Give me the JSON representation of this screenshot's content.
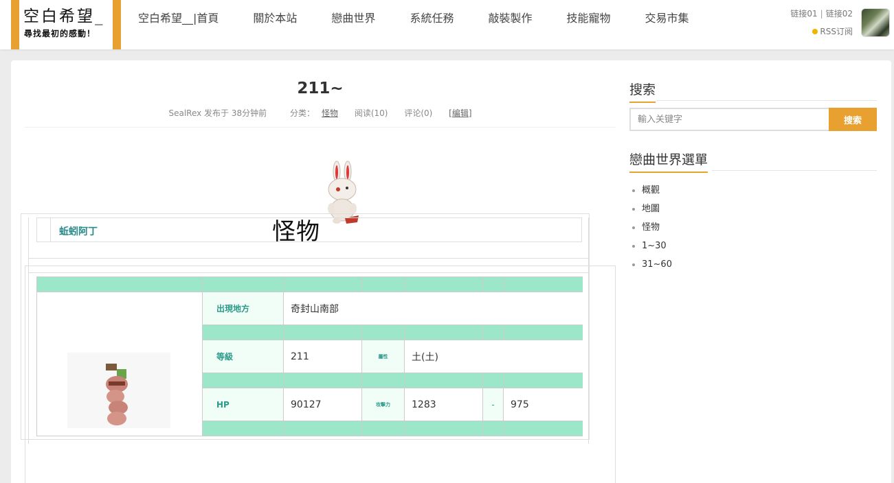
{
  "header": {
    "logo_title": "空白希望_",
    "logo_subtitle": "尋找最初的感動！",
    "nav": [
      {
        "label": "空白希望__|首頁"
      },
      {
        "label": "關於本站"
      },
      {
        "label": "戀曲世界"
      },
      {
        "label": "系統任務"
      },
      {
        "label": "敲裝製作"
      },
      {
        "label": "技能寵物"
      },
      {
        "label": "交易市集"
      }
    ],
    "link1": "链接01",
    "link_sep": "|",
    "link2": "链接02",
    "rss": "RSS订阅"
  },
  "post": {
    "title": "211~",
    "author_line": "SealRex 发布于 38分钟前",
    "category_label": "分类：",
    "category": "怪物",
    "reads": "阅读(10)",
    "comments": "评论(0)",
    "edit": "[编辑]",
    "banner_text": "怪物"
  },
  "monster": {
    "name": "蚯蚓阿丁",
    "location_label": "出現地方",
    "location": "奇封山南部",
    "level_label": "等級",
    "level": "211",
    "attr_label": "屬性",
    "attr": "土(土)",
    "hp_label": "HP",
    "hp": "90127",
    "atk_label": "攻擊力",
    "atk_min": "1283",
    "atk_sep": "-",
    "atk_max": "975"
  },
  "sidebar": {
    "search_title": "搜索",
    "search_placeholder": "輸入关键字",
    "search_button": "搜索",
    "menu_title": "戀曲世界選單",
    "menu_items": [
      {
        "label": "概觀"
      },
      {
        "label": "地圖"
      },
      {
        "label": "怪物"
      },
      {
        "label": "1~30"
      },
      {
        "label": "31~60"
      }
    ]
  },
  "colors": {
    "accent": "#e8a131",
    "table_band": "#9ce6c9",
    "label_text": "#2a9a8a"
  }
}
